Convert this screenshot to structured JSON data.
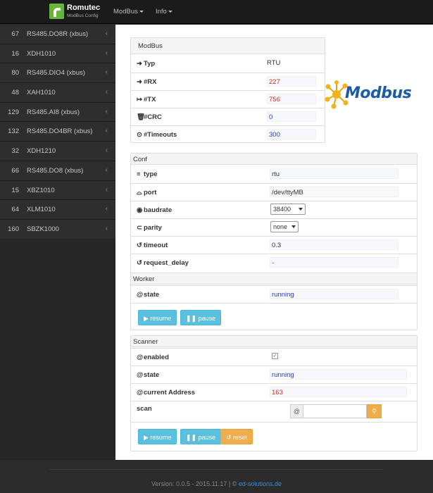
{
  "navbar": {
    "brand_title": "Romutec",
    "brand_subtitle": "ModBus Config",
    "menu": [
      {
        "label": "ModBus"
      },
      {
        "label": "Info"
      }
    ]
  },
  "sidebar": {
    "items": [
      {
        "num": "67",
        "label": "RS485.DO8R (xbus)"
      },
      {
        "num": "16",
        "label": "XDH1010"
      },
      {
        "num": "80",
        "label": "RS485.DIO4 (xbus)"
      },
      {
        "num": "48",
        "label": "XAH1010"
      },
      {
        "num": "129",
        "label": "RS485.AI8 (xbus)"
      },
      {
        "num": "132",
        "label": "RS485.DO4BR (xbus)"
      },
      {
        "num": "32",
        "label": "XDH1210"
      },
      {
        "num": "66",
        "label": "RS485.DO8 (xbus)"
      },
      {
        "num": "15",
        "label": "XBZ1010"
      },
      {
        "num": "64",
        "label": "XLM1010"
      },
      {
        "num": "160",
        "label": "SBZK1000"
      }
    ]
  },
  "modbus_panel": {
    "title": "ModBus",
    "rows": [
      {
        "key": "Typ",
        "value": "RTU"
      },
      {
        "key": "#RX",
        "value": "227"
      },
      {
        "key": "#TX",
        "value": "756"
      },
      {
        "key": "#CRC",
        "value": "0"
      },
      {
        "key": "#Timeouts",
        "value": "300"
      }
    ],
    "logo_text": "Modbus"
  },
  "conf_panel": {
    "title": "Conf",
    "type_label": "type",
    "type_value": "rtu",
    "port_label": "port",
    "port_value": "/dev/ttyMB",
    "baudrate_label": "baudrate",
    "baudrate_value": "38400",
    "parity_label": "parity",
    "parity_value": "none",
    "timeout_label": "timeout",
    "timeout_value": "0.3",
    "request_delay_label": "request_delay",
    "request_delay_value": "-"
  },
  "worker_panel": {
    "title": "Worker",
    "state_label": "state",
    "state_value": "running",
    "resume_label": "resume",
    "pause_label": "pause"
  },
  "scanner_panel": {
    "title": "Scanner",
    "enabled_label": "enabled",
    "enabled_checked": true,
    "state_label": "state",
    "state_value": "running",
    "address_label": "current Address",
    "address_value": "163",
    "scan_label": "scan",
    "scan_addon": "@",
    "scan_placeholder": "",
    "resume_label": "resume",
    "pause_label": "pause",
    "reset_label": "reset"
  },
  "footer": {
    "version_text": "Version: 0.0.5 - 2015.11.17 | ©",
    "link_text": "ed-solutions.de"
  },
  "colors": {
    "navbar_bg": "#1b1b1b",
    "sidebar_bg": "#2e2e2e",
    "info_button": "#5bc0de",
    "warning_button": "#f0ad4e",
    "value_red": "#c9302c",
    "value_blue": "#2a3fc4",
    "brand_green": "#68b33a"
  }
}
